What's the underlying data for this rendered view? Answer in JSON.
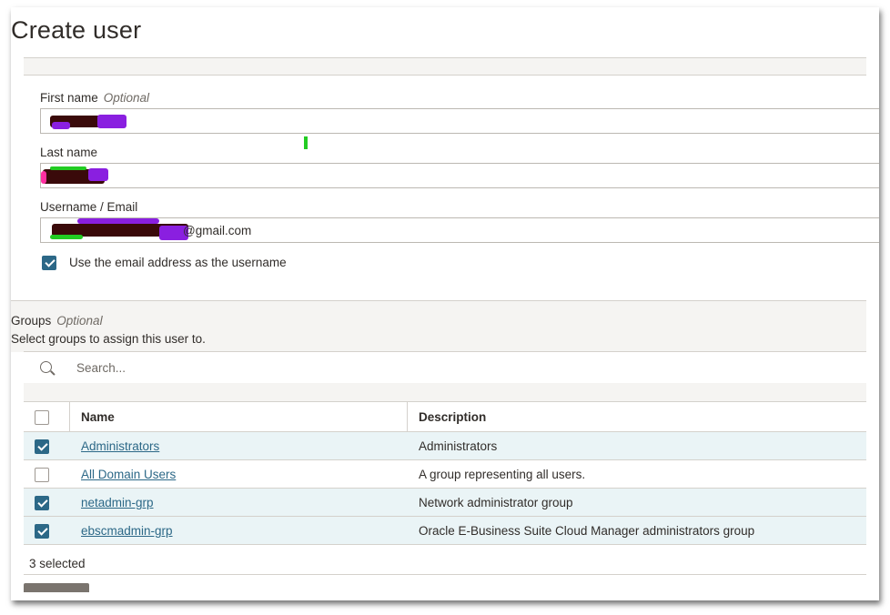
{
  "page": {
    "title": "Create user"
  },
  "form": {
    "first_name": {
      "label": "First name",
      "optional": "Optional",
      "value": ""
    },
    "last_name": {
      "label": "Last name",
      "value": ""
    },
    "username": {
      "label": "Username / Email",
      "value_suffix": "@gmail.com"
    },
    "use_email_checkbox": {
      "label": "Use the email address as the username",
      "checked": true
    }
  },
  "groups": {
    "title": "Groups",
    "optional": "Optional",
    "help": "Select groups to assign this user to.",
    "search_placeholder": "Search...",
    "columns": {
      "name": "Name",
      "description": "Description"
    },
    "rows": [
      {
        "name": "Administrators",
        "description": "Administrators",
        "checked": true
      },
      {
        "name": "All Domain Users",
        "description": "A group representing all users.",
        "checked": false
      },
      {
        "name": "netadmin-grp",
        "description": "Network administrator group",
        "checked": true
      },
      {
        "name": "ebscmadmin-grp",
        "description": "Oracle E-Business Suite Cloud Manager administrators group",
        "checked": true
      }
    ],
    "selected_count": "3 selected"
  },
  "colors": {
    "accent": "#2c6887",
    "selected_row": "#eaf4f6",
    "band": "#f5f4f2",
    "redaction_dark": "#3a0a0a",
    "redaction_purple": "#8a1fe0",
    "redaction_green": "#22cc22",
    "redaction_pink": "#ff2fa0"
  }
}
